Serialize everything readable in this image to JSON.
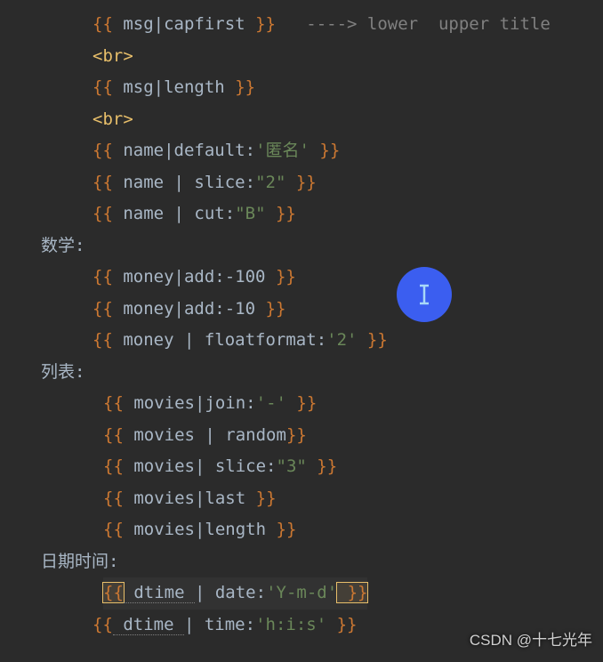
{
  "lines": {
    "l1": {
      "d1": "{{",
      "v": " msg",
      "p": "|",
      "f": "capfirst ",
      "d2": "}}",
      "cm": "   ----> lower  upper title"
    },
    "l2": {
      "open": "<",
      "tag": "br",
      "close": ">"
    },
    "l3": {
      "d1": "{{",
      "v": " msg",
      "p": "|",
      "f": "length ",
      "d2": "}}"
    },
    "l4": {
      "open": "<",
      "tag": "br",
      "close": ">"
    },
    "l5": {
      "d1": "{{",
      "v": " name",
      "p": "|",
      "f": "default:",
      "s": "'匿名'",
      "d2": " }}"
    },
    "l6": {
      "d1": "{{",
      "v": " name ",
      "p": "|",
      "f": " slice:",
      "s": "\"2\"",
      "d2": " }}"
    },
    "l7": {
      "d1": "{{",
      "v": " name ",
      "p": "|",
      "f": " cut:",
      "s": "\"B\"",
      "d2": " }}"
    },
    "h1": "数学:",
    "l8": {
      "d1": "{{",
      "v": " money",
      "p": "|",
      "f": "add:-100 ",
      "d2": "}}"
    },
    "l9": {
      "d1": "{{",
      "v": " money",
      "p": "|",
      "f": "add:-10 ",
      "d2": "}}"
    },
    "l10": {
      "d1": "{{",
      "v": " money ",
      "p": "|",
      "f": " floatformat:",
      "s": "'2'",
      "d2": " }}"
    },
    "h2": "列表:",
    "l11": {
      "d1": "{{",
      "v": " movies",
      "p": "|",
      "f": "join:",
      "s": "'-'",
      "d2": " }}"
    },
    "l12": {
      "d1": "{{",
      "v": " movies ",
      "p": "|",
      "f": " random",
      "d2": "}}"
    },
    "l13": {
      "d1": "{{",
      "v": " movies",
      "p": "|",
      "f": " slice:",
      "s": "\"3\"",
      "d2": " }}"
    },
    "l14": {
      "d1": "{{",
      "v": " movies",
      "p": "|",
      "f": "last ",
      "d2": "}}"
    },
    "l15": {
      "d1": "{{",
      "v": " movies",
      "p": "|",
      "f": "length ",
      "d2": "}}"
    },
    "h3": "日期时间:",
    "l16": {
      "d1": "{{",
      "v": " dtime ",
      "p": "|",
      "f": " date:",
      "s": "'Y-m-d'",
      "d2": " }}"
    },
    "l17": {
      "d1": "{{",
      "v": " dtime ",
      "p": "|",
      "f": " time:",
      "s": "'h:i:s'",
      "d2": " }}"
    }
  },
  "watermark": "CSDN @十七光年"
}
